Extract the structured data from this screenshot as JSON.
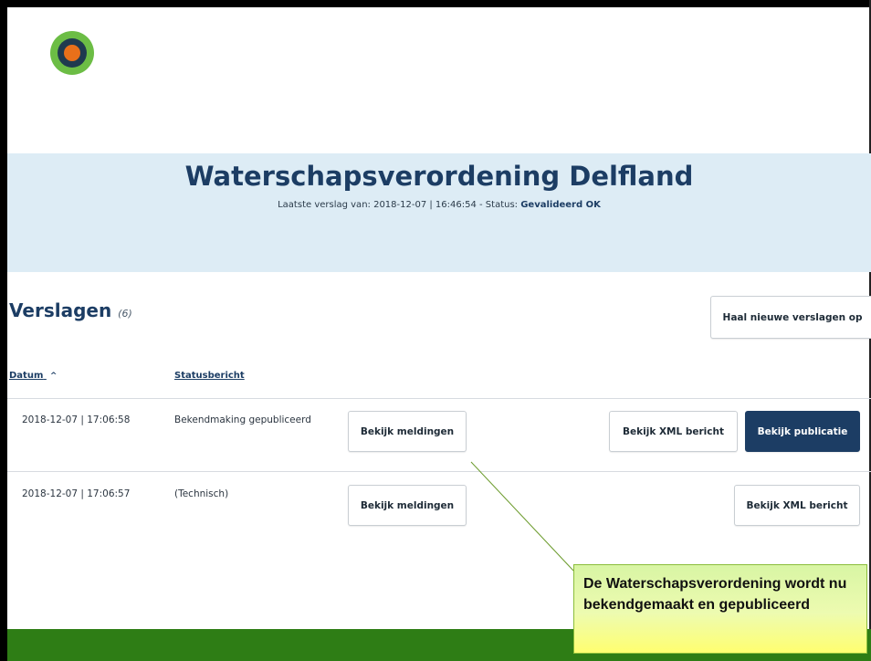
{
  "hero": {
    "title": "Waterschapsverordening Delfland",
    "subtitle_prefix": "Laatste verslag van: 2018-12-07 | 16:46:54 - Status: ",
    "status_value": "Gevalideerd OK"
  },
  "verslagen": {
    "title": "Verslagen",
    "count": "(6)",
    "refresh_button": "Haal nieuwe verslagen op"
  },
  "table": {
    "col_datum": "Datum",
    "sort_indicator": "^",
    "col_statusbericht": "Statusbericht",
    "rows": [
      {
        "datum": "2018-12-07 | 17:06:58",
        "status": "Bekendmaking gepubliceerd",
        "meldingen": "Bekijk meldingen",
        "xml": "Bekijk XML bericht",
        "publicatie": "Bekijk publicatie"
      },
      {
        "datum": "2018-12-07 | 17:06:57",
        "status": "(Technisch)",
        "meldingen": "Bekijk meldingen",
        "xml": "Bekijk XML bericht"
      }
    ]
  },
  "callout": {
    "text": "De Waterschapsverordening wordt nu bekendgemaakt en gepubliceerd"
  },
  "colors": {
    "primary": "#1c3d64",
    "hero_bg": "#ddecf5",
    "footer_green": "#2e7d15",
    "logo_green": "#6cbd45",
    "logo_orange": "#e8701a"
  }
}
